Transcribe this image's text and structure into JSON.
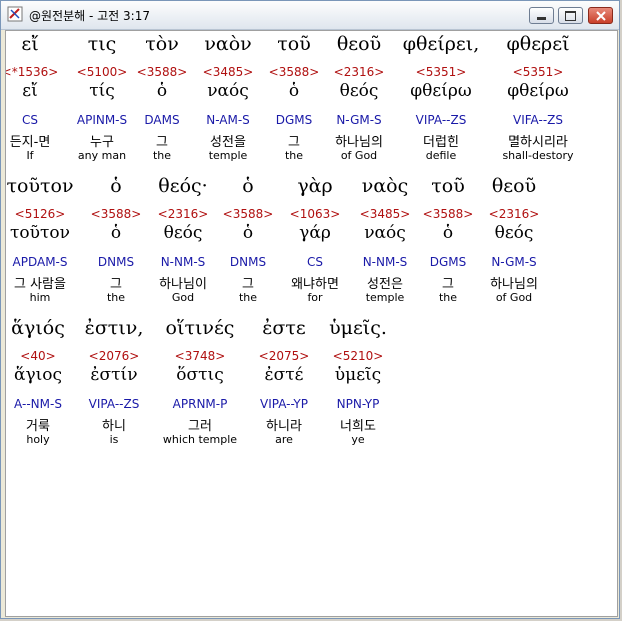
{
  "window": {
    "title": "@원전분해 - 고전 3:17",
    "icons": {
      "app": "bible-app-icon",
      "minimize": "minimize-icon",
      "maximize": "maximize-icon",
      "close": "close-icon"
    },
    "colors": {
      "strong": "#b01010",
      "parse": "#1a1aa8",
      "text": "#000000"
    }
  },
  "rows": [
    {
      "words": [
        {
          "greek": "εἴ",
          "strong": "<*1536>",
          "lemma": "εἴ",
          "parse": "CS",
          "korean": "든지-면",
          "english": "If"
        },
        {
          "greek": "τις",
          "strong": "<5100>",
          "lemma": "τίς",
          "parse": "APINM-S",
          "korean": "누구",
          "english": "any man"
        },
        {
          "greek": "τὸν",
          "strong": "<3588>",
          "lemma": "ὁ",
          "parse": "DAMS",
          "korean": "그",
          "english": "the"
        },
        {
          "greek": "ναὸν",
          "strong": "<3485>",
          "lemma": "ναός",
          "parse": "N-AM-S",
          "korean": "성전을",
          "english": "temple"
        },
        {
          "greek": "τοῦ",
          "strong": "<3588>",
          "lemma": "ὁ",
          "parse": "DGMS",
          "korean": "그",
          "english": "the"
        },
        {
          "greek": "θεοῦ",
          "strong": "<2316>",
          "lemma": "θεός",
          "parse": "N-GM-S",
          "korean": "하나님의",
          "english": "of God"
        },
        {
          "greek": "φθείρει,",
          "strong": "<5351>",
          "lemma": "φθείρω",
          "parse": "VIPA--ZS",
          "korean": "더럽힌",
          "english": "defile"
        },
        {
          "greek": "φθερεῖ",
          "strong": "<5351>",
          "lemma": "φθείρω",
          "parse": "VIFA--ZS",
          "korean": "멸하시리라",
          "english": "shall-destory"
        }
      ]
    },
    {
      "words": [
        {
          "greek": "τοῦτον",
          "strong": "<5126>",
          "lemma": "τοῦτον",
          "parse": "APDAM-S",
          "korean": "그 사람을",
          "english": "him"
        },
        {
          "greek": "ὁ",
          "strong": "<3588>",
          "lemma": "ὁ",
          "parse": "DNMS",
          "korean": "그",
          "english": "the"
        },
        {
          "greek": "θεός·",
          "strong": "<2316>",
          "lemma": "θεός",
          "parse": "N-NM-S",
          "korean": "하나님이",
          "english": "God"
        },
        {
          "greek": "ὁ",
          "strong": "<3588>",
          "lemma": "ὁ",
          "parse": "DNMS",
          "korean": "그",
          "english": "the"
        },
        {
          "greek": "γὰρ",
          "strong": "<1063>",
          "lemma": "γάρ",
          "parse": "CS",
          "korean": "왜냐하면",
          "english": "for"
        },
        {
          "greek": "ναὸς",
          "strong": "<3485>",
          "lemma": "ναός",
          "parse": "N-NM-S",
          "korean": "성전은",
          "english": "temple"
        },
        {
          "greek": "τοῦ",
          "strong": "<3588>",
          "lemma": "ὁ",
          "parse": "DGMS",
          "korean": "그",
          "english": "the"
        },
        {
          "greek": "θεοῦ",
          "strong": "<2316>",
          "lemma": "θεός",
          "parse": "N-GM-S",
          "korean": "하나님의",
          "english": "of God"
        }
      ]
    },
    {
      "words": [
        {
          "greek": "ἅγιός",
          "strong": "<40>",
          "lemma": "ἅγιος",
          "parse": "A--NM-S",
          "korean": "거룩",
          "english": "holy"
        },
        {
          "greek": "ἐστιν,",
          "strong": "<2076>",
          "lemma": "ἐστίν",
          "parse": "VIPA--ZS",
          "korean": "하니",
          "english": "is"
        },
        {
          "greek": "οἵτινές",
          "strong": "<3748>",
          "lemma": "ὅστις",
          "parse": "APRNM-P",
          "korean": "그러",
          "english": "which temple"
        },
        {
          "greek": "ἐστε",
          "strong": "<2075>",
          "lemma": "ἐστέ",
          "parse": "VIPA--YP",
          "korean": "하니라",
          "english": "are"
        },
        {
          "greek": "ὑμεῖς.",
          "strong": "<5210>",
          "lemma": "ὑμεῖς",
          "parse": "NPN-YP",
          "korean": "너희도",
          "english": "ye"
        }
      ]
    }
  ]
}
